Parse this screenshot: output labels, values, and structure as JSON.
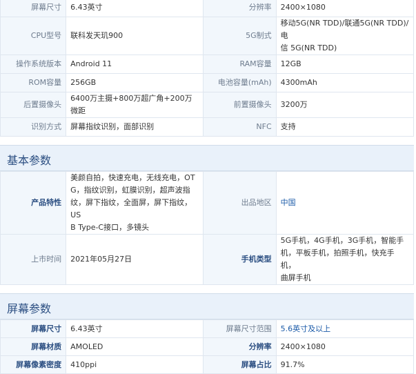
{
  "top_table": {
    "rows": [
      {
        "k1": "屏幕尺寸",
        "v1": "6.43英寸",
        "k2": "分辨率",
        "v2": "2400×1080"
      },
      {
        "k1": "CPU型号",
        "v1": "联科发天玑900",
        "k2": "5G制式",
        "v2a": "移动5G(NR TDD)/联通5G(NR TDD)/电",
        "v2b": "信 5G(NR TDD)"
      },
      {
        "k1": "操作系统版本",
        "v1": "Android 11",
        "k2": "RAM容量",
        "v2": "12GB"
      },
      {
        "k1": "ROM容量",
        "v1": "256GB",
        "k2": "电池容量(mAh)",
        "v2": "4300mAh"
      },
      {
        "k1": "后置摄像头",
        "v1": "6400万主摄+800万超广角+200万微距",
        "k2": "前置摄像头",
        "v2": "3200万"
      },
      {
        "k1": "识别方式",
        "v1": "屏幕指纹识别，面部识别",
        "k2": "NFC",
        "v2": "支持"
      }
    ]
  },
  "basic": {
    "title": "基本参数",
    "feature_label": "产品特性",
    "feature_lines": [
      "美颜自拍，快速充电，无线充电，OT",
      "G，指纹识别，虹膜识别，超声波指",
      "纹，屏下指纹，全面屏，屏下指纹，US",
      "B Type-C接口，多镜头"
    ],
    "origin_label": "出品地区",
    "origin_value": "中国",
    "date_label": "上市时间",
    "date_value": "2021年05月27日",
    "type_label": "手机类型",
    "type_lines": [
      "5G手机，4G手机，3G手机，智能手",
      "机，平板手机，拍照手机，快充手机，",
      "曲屏手机"
    ]
  },
  "screen": {
    "title": "屏幕参数",
    "rows": [
      {
        "k1": "屏幕尺寸",
        "v1": "6.43英寸",
        "k2": "屏幕尺寸范围",
        "v2": "5.6英寸及以上"
      },
      {
        "k1": "屏幕材质",
        "v1": "AMOLED",
        "k2": "分辨率",
        "v2": "2400×1080"
      },
      {
        "k1": "屏幕像素密度",
        "v1": "410ppi",
        "k2": "屏幕占比",
        "v2": "91.7%"
      }
    ]
  }
}
